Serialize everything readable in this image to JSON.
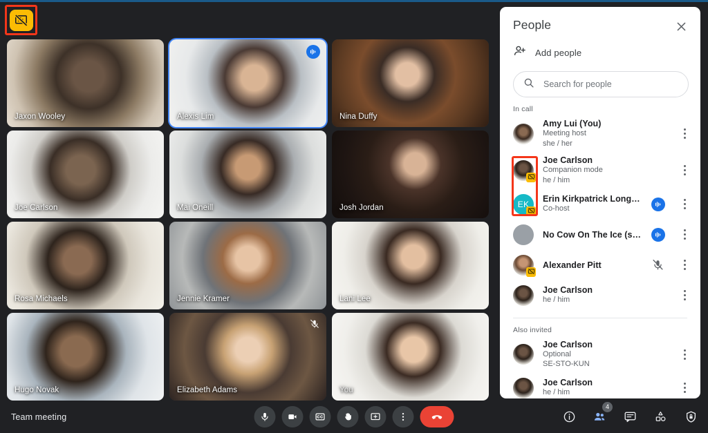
{
  "window": {
    "background": "#202124",
    "accent_blue": "#1a73e8",
    "highlight_red": "#f4361a",
    "badge_yellow": "#fbbc04"
  },
  "present_badge": {
    "icon": "presentation-off-icon",
    "tooltip": "Presenting off"
  },
  "grid": {
    "tiles": [
      {
        "name": "Jaxon Wooley",
        "speaking": false,
        "muted": false,
        "self": false
      },
      {
        "name": "Alexis Lim",
        "speaking": true,
        "muted": false,
        "self": false
      },
      {
        "name": "Nina Duffy",
        "speaking": false,
        "muted": false,
        "self": false
      },
      {
        "name": "Joe Carlson",
        "speaking": false,
        "muted": false,
        "self": false
      },
      {
        "name": "Mai Oneill",
        "speaking": false,
        "muted": false,
        "self": false
      },
      {
        "name": "Josh Jordan",
        "speaking": false,
        "muted": false,
        "self": false
      },
      {
        "name": "Rosa Michaels",
        "speaking": false,
        "muted": false,
        "self": false
      },
      {
        "name": "Jennie Kramer",
        "speaking": false,
        "muted": false,
        "self": false
      },
      {
        "name": "Lani Lee",
        "speaking": false,
        "muted": false,
        "self": false
      },
      {
        "name": "Hugo Novak",
        "speaking": false,
        "muted": false,
        "self": false
      },
      {
        "name": "Elizabeth Adams",
        "speaking": false,
        "muted": true,
        "self": false
      },
      {
        "name": "You",
        "speaking": false,
        "muted": false,
        "self": true
      }
    ]
  },
  "panel": {
    "title": "People",
    "close_icon": "close-icon",
    "add_people": {
      "label": "Add people",
      "icon": "person-add-icon"
    },
    "search": {
      "placeholder": "Search for people",
      "value": "",
      "icon": "search-icon"
    },
    "sections": [
      {
        "label": "In call",
        "people": [
          {
            "name": "Amy Lui (You)",
            "line2": "Meeting host",
            "line3": "she / her",
            "avatar": "av-amy",
            "initials": "",
            "companion": false,
            "audio": "none"
          },
          {
            "name": "Joe Carlson",
            "line2": "Companion mode",
            "line3": "he / him",
            "avatar": "av-joe",
            "initials": "",
            "companion": true,
            "audio": "none"
          },
          {
            "name": "Erin Kirkpatrick Long nam...",
            "line2": "Co-host",
            "line3": "",
            "avatar": "av-ek",
            "initials": "EK",
            "companion": true,
            "audio": "speaking"
          },
          {
            "name": "No Cow On The Ice (se-sto..",
            "line2": "",
            "line3": "",
            "avatar": "av-grey",
            "initials": "",
            "companion": false,
            "audio": "speaking"
          },
          {
            "name": "Alexander Pitt",
            "line2": "",
            "line3": "",
            "avatar": "av-alex",
            "initials": "",
            "companion": true,
            "audio": "muted"
          },
          {
            "name": "Joe Carlson",
            "line2": "he / him",
            "line3": "",
            "avatar": "av-joe",
            "initials": "",
            "companion": false,
            "audio": "none"
          }
        ]
      },
      {
        "label": "Also invited",
        "people": [
          {
            "name": "Joe Carlson",
            "line2": "Optional",
            "line3": "SE-STO-KUN",
            "avatar": "av-joe",
            "initials": "",
            "companion": false,
            "audio": "none"
          },
          {
            "name": "Joe Carlson",
            "line2": "he / him",
            "line3": "",
            "avatar": "av-joe",
            "initials": "",
            "companion": false,
            "audio": "none"
          }
        ]
      }
    ]
  },
  "bottombar": {
    "meeting_name": "Team meeting",
    "center": [
      {
        "icon": "microphone-icon",
        "name": "toggle-microphone-button"
      },
      {
        "icon": "camera-icon",
        "name": "toggle-camera-button"
      },
      {
        "icon": "closed-captions-icon",
        "name": "captions-button"
      },
      {
        "icon": "raise-hand-icon",
        "name": "raise-hand-button"
      },
      {
        "icon": "present-screen-icon",
        "name": "present-now-button"
      },
      {
        "icon": "more-vertical-icon",
        "name": "more-options-button"
      },
      {
        "icon": "end-call-icon",
        "name": "leave-call-button"
      }
    ],
    "right": [
      {
        "icon": "info-icon",
        "name": "meeting-details-button",
        "active": false,
        "badge": ""
      },
      {
        "icon": "people-icon",
        "name": "show-people-button",
        "active": true,
        "badge": "4"
      },
      {
        "icon": "chat-icon",
        "name": "chat-button",
        "active": false,
        "badge": ""
      },
      {
        "icon": "activities-icon",
        "name": "activities-button",
        "active": false,
        "badge": ""
      },
      {
        "icon": "host-controls-shield-icon",
        "name": "host-controls-button",
        "active": false,
        "badge": ""
      }
    ]
  }
}
